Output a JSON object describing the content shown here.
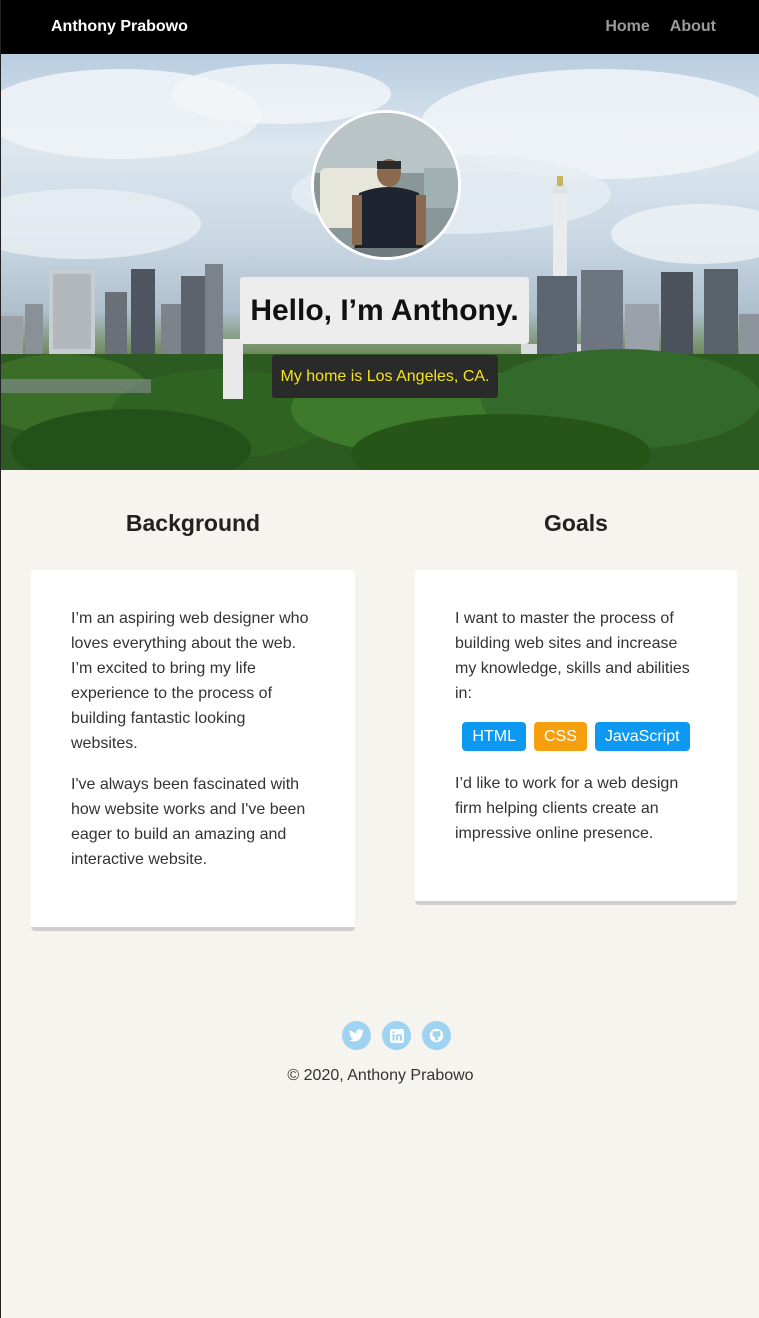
{
  "navbar": {
    "brand": "Anthony Prabowo",
    "links": [
      {
        "label": "Home"
      },
      {
        "label": "About"
      }
    ]
  },
  "hero": {
    "title": "Hello, I’m Anthony.",
    "subtitle": "My home is Los Angeles, CA."
  },
  "background": {
    "heading": "Background",
    "paragraphs": [
      "I’m an aspiring web designer who loves everything about the web. I’m excited to bring my life experience to the process of building fantastic looking websites.",
      "I've always been fascinated with how website works and I've been eager to build an amazing and interactive website."
    ]
  },
  "goals": {
    "heading": "Goals",
    "intro": "I want to master the process of building web sites and increase my knowledge, skills and abilities in:",
    "tags": [
      {
        "label": "HTML",
        "color": "#0d99f2"
      },
      {
        "label": "CSS",
        "color": "#f7a00f"
      },
      {
        "label": "JavaScript",
        "color": "#0d99f2"
      }
    ],
    "outro": "I’d like to work for a web design firm helping clients create an impressive online presence."
  },
  "footer": {
    "socials": [
      {
        "icon": "twitter-icon"
      },
      {
        "icon": "linkedin-icon"
      },
      {
        "icon": "github-icon"
      }
    ],
    "copyright": "© 2020, Anthony Prabowo"
  },
  "colors": {
    "navbar_bg": "#000000",
    "page_bg": "#f5f4ef",
    "subtitle_text": "#f4e41a",
    "social_icon_bg": "#9ed3f2"
  }
}
